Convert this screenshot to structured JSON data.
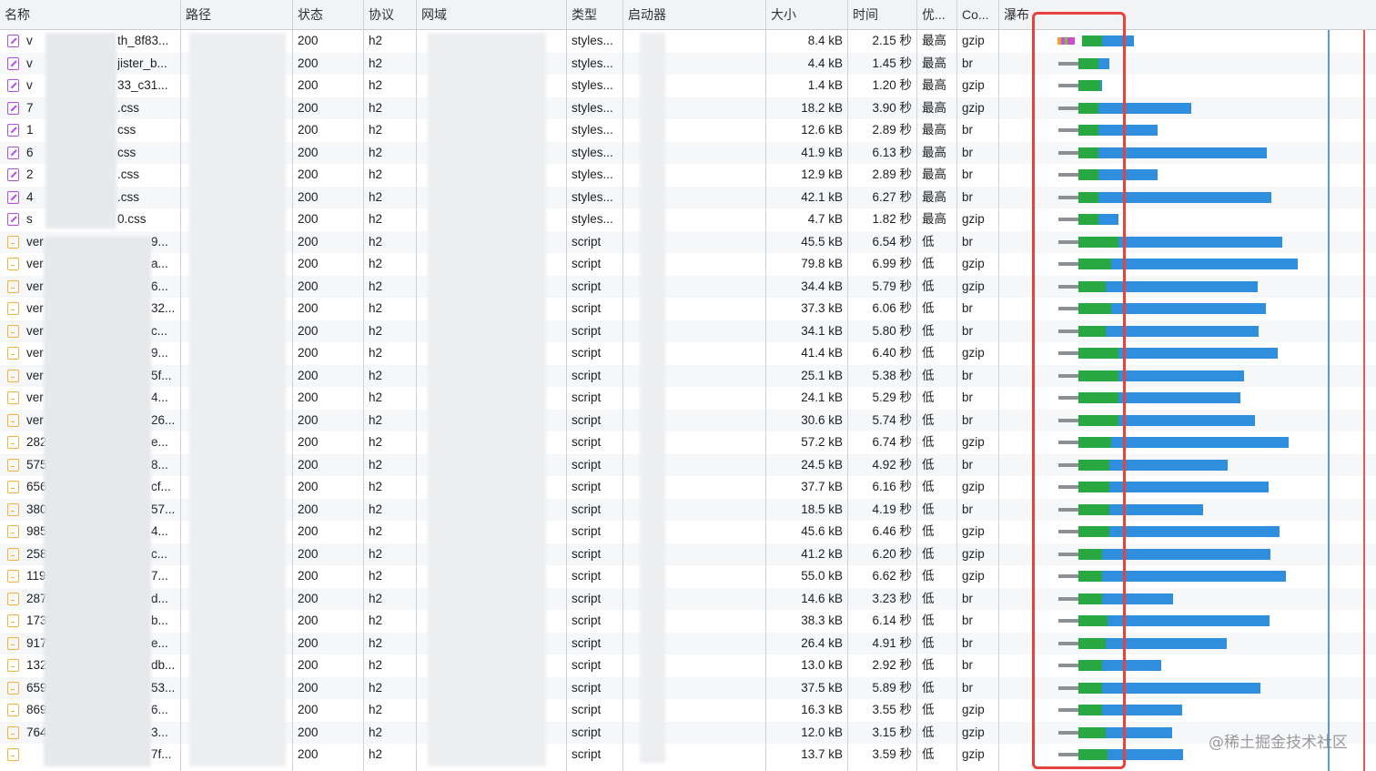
{
  "columns": {
    "name": "名称",
    "path": "路径",
    "status": "状态",
    "protocol": "协议",
    "domain": "网域",
    "type": "类型",
    "initiator": "启动器",
    "size": "大小",
    "time": "时间",
    "priority": "优...",
    "content_encoding": "Co...",
    "waterfall": "瀑布"
  },
  "rows": [
    {
      "icon": "css-file-icon",
      "name_prefix": "v",
      "name_suffix": "th_8f83...",
      "status": "200",
      "protocol": "h2",
      "type": "styles...",
      "size": "8.4 kB",
      "time": "2.15 秒",
      "priority": "最高",
      "encoding": "gzip",
      "wf_gray": 0,
      "wf_green": 22,
      "wf_blue": 35
    },
    {
      "icon": "css-file-icon",
      "name_prefix": "v",
      "name_suffix": "jister_b...",
      "status": "200",
      "protocol": "h2",
      "type": "styles...",
      "size": "4.4 kB",
      "time": "1.45 秒",
      "priority": "最高",
      "encoding": "br",
      "wf_gray": 1,
      "wf_green": 22,
      "wf_blue": 12
    },
    {
      "icon": "css-file-icon",
      "name_prefix": "v",
      "name_suffix": "33_c31...",
      "status": "200",
      "protocol": "h2",
      "type": "styles...",
      "size": "1.4 kB",
      "time": "1.20 秒",
      "priority": "最高",
      "encoding": "gzip",
      "wf_gray": 1,
      "wf_green": 24,
      "wf_blue": 2
    },
    {
      "icon": "css-file-icon",
      "name_prefix": "7",
      "name_suffix": ".css",
      "status": "200",
      "protocol": "h2",
      "type": "styles...",
      "size": "18.2 kB",
      "time": "3.90 秒",
      "priority": "最高",
      "encoding": "gzip",
      "wf_gray": 1,
      "wf_green": 22,
      "wf_blue": 102
    },
    {
      "icon": "css-file-icon",
      "name_prefix": "1",
      "name_suffix": "css",
      "status": "200",
      "protocol": "h2",
      "type": "styles...",
      "size": "12.6 kB",
      "time": "2.89 秒",
      "priority": "最高",
      "encoding": "br",
      "wf_gray": 1,
      "wf_green": 22,
      "wf_blue": 65
    },
    {
      "icon": "css-file-icon",
      "name_prefix": "6",
      "name_suffix": "css",
      "status": "200",
      "protocol": "h2",
      "type": "styles...",
      "size": "41.9 kB",
      "time": "6.13 秒",
      "priority": "最高",
      "encoding": "br",
      "wf_gray": 1,
      "wf_green": 22,
      "wf_blue": 185
    },
    {
      "icon": "css-file-icon",
      "name_prefix": "2",
      "name_suffix": ".css",
      "status": "200",
      "protocol": "h2",
      "type": "styles...",
      "size": "12.9 kB",
      "time": "2.89 秒",
      "priority": "最高",
      "encoding": "br",
      "wf_gray": 1,
      "wf_green": 22,
      "wf_blue": 65
    },
    {
      "icon": "css-file-icon",
      "name_prefix": "4",
      "name_suffix": ".css",
      "status": "200",
      "protocol": "h2",
      "type": "styles...",
      "size": "42.1 kB",
      "time": "6.27 秒",
      "priority": "最高",
      "encoding": "br",
      "wf_gray": 1,
      "wf_green": 22,
      "wf_blue": 190
    },
    {
      "icon": "css-file-icon",
      "name_prefix": "s",
      "name_suffix": "0.css",
      "status": "200",
      "protocol": "h2",
      "type": "styles...",
      "size": "4.7 kB",
      "time": "1.82 秒",
      "priority": "最高",
      "encoding": "gzip",
      "wf_gray": 1,
      "wf_green": 22,
      "wf_blue": 22
    },
    {
      "icon": "js-file-icon",
      "name_prefix": "ver",
      "name_suffix": "9...",
      "status": "200",
      "protocol": "h2",
      "type": "script",
      "size": "45.5 kB",
      "time": "6.54 秒",
      "priority": "低",
      "encoding": "br",
      "wf_gray": 1,
      "wf_green": 44,
      "wf_blue": 180
    },
    {
      "icon": "js-file-icon",
      "name_prefix": "ver",
      "name_suffix": "a...",
      "status": "200",
      "protocol": "h2",
      "type": "script",
      "size": "79.8 kB",
      "time": "6.99 秒",
      "priority": "低",
      "encoding": "gzip",
      "wf_gray": 1,
      "wf_green": 36,
      "wf_blue": 205
    },
    {
      "icon": "js-file-icon",
      "name_prefix": "ver",
      "name_suffix": "6...",
      "status": "200",
      "protocol": "h2",
      "type": "script",
      "size": "34.4 kB",
      "time": "5.79 秒",
      "priority": "低",
      "encoding": "gzip",
      "wf_gray": 1,
      "wf_green": 30,
      "wf_blue": 167
    },
    {
      "icon": "js-file-icon",
      "name_prefix": "ver",
      "name_suffix": "32...",
      "status": "200",
      "protocol": "h2",
      "type": "script",
      "size": "37.3 kB",
      "time": "6.06 秒",
      "priority": "低",
      "encoding": "br",
      "wf_gray": 1,
      "wf_green": 36,
      "wf_blue": 170
    },
    {
      "icon": "js-file-icon",
      "name_prefix": "ver",
      "name_suffix": "c...",
      "status": "200",
      "protocol": "h2",
      "type": "script",
      "size": "34.1 kB",
      "time": "5.80 秒",
      "priority": "低",
      "encoding": "br",
      "wf_gray": 1,
      "wf_green": 30,
      "wf_blue": 168
    },
    {
      "icon": "js-file-icon",
      "name_prefix": "ver",
      "name_suffix": "9...",
      "status": "200",
      "protocol": "h2",
      "type": "script",
      "size": "41.4 kB",
      "time": "6.40 秒",
      "priority": "低",
      "encoding": "gzip",
      "wf_gray": 1,
      "wf_green": 44,
      "wf_blue": 175
    },
    {
      "icon": "js-file-icon",
      "name_prefix": "ver",
      "name_suffix": "5f...",
      "status": "200",
      "protocol": "h2",
      "type": "script",
      "size": "25.1 kB",
      "time": "5.38 秒",
      "priority": "低",
      "encoding": "br",
      "wf_gray": 1,
      "wf_green": 44,
      "wf_blue": 138
    },
    {
      "icon": "js-file-icon",
      "name_prefix": "ver",
      "name_suffix": "4...",
      "status": "200",
      "protocol": "h2",
      "type": "script",
      "size": "24.1 kB",
      "time": "5.29 秒",
      "priority": "低",
      "encoding": "br",
      "wf_gray": 1,
      "wf_green": 44,
      "wf_blue": 134
    },
    {
      "icon": "js-file-icon",
      "name_prefix": "ver",
      "name_suffix": "26...",
      "status": "200",
      "protocol": "h2",
      "type": "script",
      "size": "30.6 kB",
      "time": "5.74 秒",
      "priority": "低",
      "encoding": "br",
      "wf_gray": 1,
      "wf_green": 44,
      "wf_blue": 150
    },
    {
      "icon": "js-file-icon",
      "name_prefix": "282",
      "name_suffix": "e...",
      "status": "200",
      "protocol": "h2",
      "type": "script",
      "size": "57.2 kB",
      "time": "6.74 秒",
      "priority": "低",
      "encoding": "gzip",
      "wf_gray": 1,
      "wf_green": 36,
      "wf_blue": 195
    },
    {
      "icon": "js-file-icon",
      "name_prefix": "575",
      "name_suffix": "8...",
      "status": "200",
      "protocol": "h2",
      "type": "script",
      "size": "24.5 kB",
      "time": "4.92 秒",
      "priority": "低",
      "encoding": "br",
      "wf_gray": 1,
      "wf_green": 34,
      "wf_blue": 130
    },
    {
      "icon": "js-file-icon",
      "name_prefix": "656",
      "name_suffix": "cf...",
      "status": "200",
      "protocol": "h2",
      "type": "script",
      "size": "37.7 kB",
      "time": "6.16 秒",
      "priority": "低",
      "encoding": "gzip",
      "wf_gray": 1,
      "wf_green": 34,
      "wf_blue": 175
    },
    {
      "icon": "js-file-icon",
      "name_prefix": "380",
      "name_suffix": "57...",
      "status": "200",
      "protocol": "h2",
      "type": "script",
      "size": "18.5 kB",
      "time": "4.19 秒",
      "priority": "低",
      "encoding": "br",
      "wf_gray": 1,
      "wf_green": 34,
      "wf_blue": 103
    },
    {
      "icon": "js-file-icon",
      "name_prefix": "985",
      "name_suffix": "4...",
      "status": "200",
      "protocol": "h2",
      "type": "script",
      "size": "45.6 kB",
      "time": "6.46 秒",
      "priority": "低",
      "encoding": "gzip",
      "wf_gray": 1,
      "wf_green": 34,
      "wf_blue": 187
    },
    {
      "icon": "js-file-icon",
      "name_prefix": "258",
      "name_suffix": "c...",
      "status": "200",
      "protocol": "h2",
      "type": "script",
      "size": "41.2 kB",
      "time": "6.20 秒",
      "priority": "低",
      "encoding": "gzip",
      "wf_gray": 1,
      "wf_green": 26,
      "wf_blue": 185
    },
    {
      "icon": "js-file-icon",
      "name_prefix": "119",
      "name_suffix": "7...",
      "status": "200",
      "protocol": "h2",
      "type": "script",
      "size": "55.0 kB",
      "time": "6.62 秒",
      "priority": "低",
      "encoding": "gzip",
      "wf_gray": 1,
      "wf_green": 26,
      "wf_blue": 202
    },
    {
      "icon": "js-file-icon",
      "name_prefix": "287",
      "name_suffix": "d...",
      "status": "200",
      "protocol": "h2",
      "type": "script",
      "size": "14.6 kB",
      "time": "3.23 秒",
      "priority": "低",
      "encoding": "br",
      "wf_gray": 1,
      "wf_green": 26,
      "wf_blue": 78
    },
    {
      "icon": "js-file-icon",
      "name_prefix": "173",
      "name_suffix": "b...",
      "status": "200",
      "protocol": "h2",
      "type": "script",
      "size": "38.3 kB",
      "time": "6.14 秒",
      "priority": "低",
      "encoding": "br",
      "wf_gray": 1,
      "wf_green": 32,
      "wf_blue": 178
    },
    {
      "icon": "js-file-icon",
      "name_prefix": "917",
      "name_suffix": "e...",
      "status": "200",
      "protocol": "h2",
      "type": "script",
      "size": "26.4 kB",
      "time": "4.91 秒",
      "priority": "低",
      "encoding": "br",
      "wf_gray": 1,
      "wf_green": 30,
      "wf_blue": 133
    },
    {
      "icon": "js-file-icon",
      "name_prefix": "132",
      "name_suffix": "db...",
      "status": "200",
      "protocol": "h2",
      "type": "script",
      "size": "13.0 kB",
      "time": "2.92 秒",
      "priority": "低",
      "encoding": "br",
      "wf_gray": 1,
      "wf_green": 26,
      "wf_blue": 65
    },
    {
      "icon": "js-file-icon",
      "name_prefix": "659",
      "name_suffix": "53...",
      "status": "200",
      "protocol": "h2",
      "type": "script",
      "size": "37.5 kB",
      "time": "5.89 秒",
      "priority": "低",
      "encoding": "br",
      "wf_gray": 1,
      "wf_green": 26,
      "wf_blue": 174
    },
    {
      "icon": "js-file-icon",
      "name_prefix": "869",
      "name_suffix": "6...",
      "status": "200",
      "protocol": "h2",
      "type": "script",
      "size": "16.3 kB",
      "time": "3.55 秒",
      "priority": "低",
      "encoding": "gzip",
      "wf_gray": 1,
      "wf_green": 26,
      "wf_blue": 88
    },
    {
      "icon": "js-file-icon",
      "name_prefix": "764",
      "name_suffix": "3...",
      "status": "200",
      "protocol": "h2",
      "type": "script",
      "size": "12.0 kB",
      "time": "3.15 秒",
      "priority": "低",
      "encoding": "gzip",
      "wf_gray": 1,
      "wf_green": 30,
      "wf_blue": 73
    },
    {
      "icon": "js-file-icon",
      "name_prefix": "",
      "name_suffix": "7f...",
      "status": "200",
      "protocol": "h2",
      "type": "script",
      "size": "13.7 kB",
      "time": "3.59 秒",
      "priority": "低",
      "encoding": "gzip",
      "wf_gray": 1,
      "wf_green": 32,
      "wf_blue": 83
    }
  ],
  "watermark": "@稀土掘金技术社区",
  "colors": {
    "waterfall_wait": "#8c8f93",
    "waterfall_ttfb": "#27a841",
    "waterfall_download": "#2f8fde",
    "dom_content_loaded_line": "#5b9bdc",
    "load_line": "#e25a55",
    "annotation_box": "#e9413d",
    "header_bg": "#f1f3f4",
    "row_stripe": "#f5f7f9"
  }
}
